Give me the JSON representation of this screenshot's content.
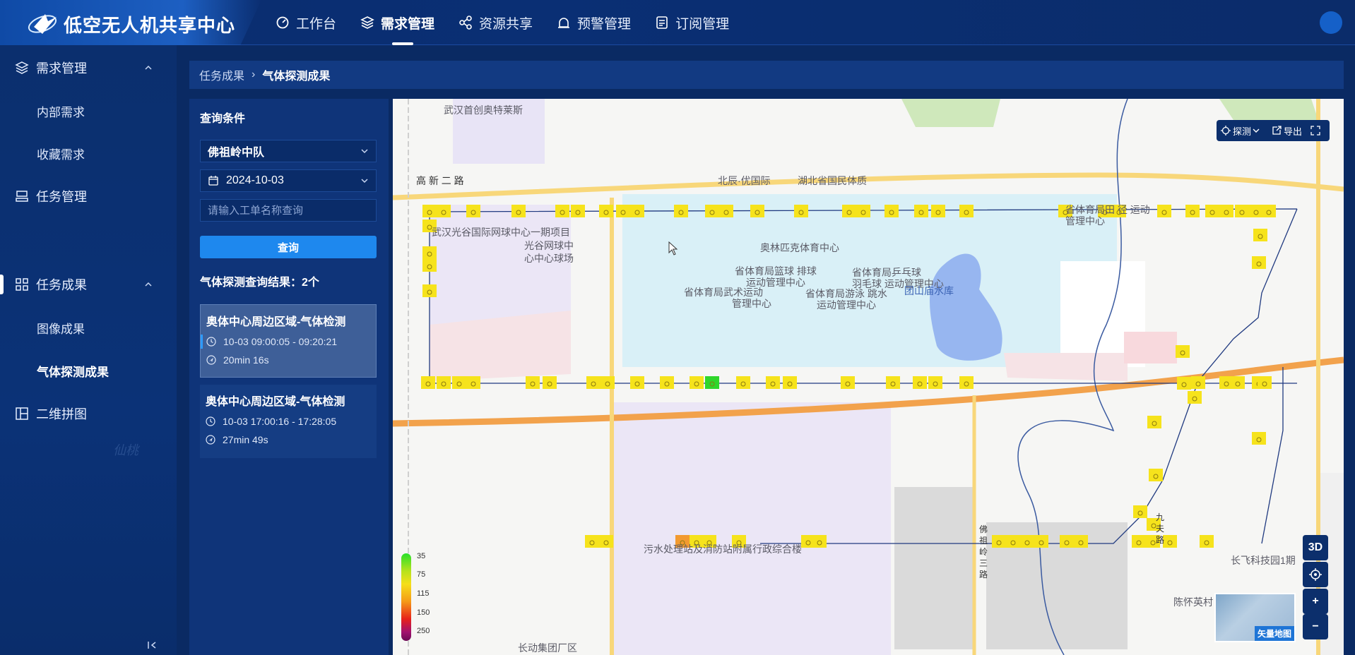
{
  "app": {
    "title": "低空无人机共享中心"
  },
  "nav": [
    {
      "label": "工作台",
      "icon": "dashboard-icon"
    },
    {
      "label": "需求管理",
      "icon": "layers-icon",
      "active": true
    },
    {
      "label": "资源共享",
      "icon": "share-icon"
    },
    {
      "label": "预警管理",
      "icon": "alarm-icon"
    },
    {
      "label": "订阅管理",
      "icon": "subscription-icon"
    }
  ],
  "sidebar": {
    "groups": [
      {
        "label": "需求管理",
        "icon": "layers-icon",
        "expanded": true
      },
      {
        "label": "任务管理",
        "icon": "task-icon"
      },
      {
        "label": "任务成果",
        "icon": "grid-icon",
        "expanded": true
      },
      {
        "label": "二维拼图",
        "icon": "mosaic-icon"
      }
    ],
    "subitems": {
      "demand": [
        "内部需求",
        "收藏需求"
      ],
      "results": [
        "图像成果",
        "气体探测成果"
      ]
    }
  },
  "breadcrumb": {
    "parent": "任务成果",
    "current": "气体探测成果"
  },
  "query": {
    "title": "查询条件",
    "team": "佛祖岭中队",
    "date": "2024-10-03",
    "search_placeholder": "请输入工单名称查询",
    "search_button": "查询",
    "result_count_text": "气体探测查询结果：2个"
  },
  "results": [
    {
      "title": "奥体中心周边区域-气体检测",
      "time": "10-03  09:00:05 - 09:20:21",
      "duration": "20min 16s",
      "active": true
    },
    {
      "title": "奥体中心周边区域-气体检测",
      "time": "10-03  17:00:16 - 17:28:05",
      "duration": "27min 49s",
      "active": false
    }
  ],
  "map": {
    "tools": {
      "detect": "探测",
      "export": "导出"
    },
    "controls": {
      "view3d": "3D",
      "zoom_in": "+",
      "zoom_out": "−"
    },
    "minimap_label": "矢量地图",
    "legend": [
      "35",
      "75",
      "115",
      "150",
      "250"
    ],
    "labels": {
      "outlet": "武汉首创奥特莱斯",
      "road1": "高 新 二 路",
      "beichen": "北辰·优国际",
      "hubei": "湖北省国民体质",
      "tennis": "武汉光谷国际网球中心一期项目",
      "tennis2": "光谷网球中",
      "tennis3": "心中心球场",
      "olympic": "奥林匹克体育中心",
      "basketball": "省体育局篮球 排球",
      "basketball2": "运动管理中心",
      "pingpong": "省体育局乒乓球",
      "pingpong2": "羽毛球 运动管理中心",
      "martial": "省体育局武术运动",
      "martial2": "管理中心",
      "swim": "省体育局游泳 跳水",
      "swim2": "运动管理中心",
      "reservoir": "团山庙水库",
      "track": "省体育局田 径 运动",
      "track2": "管理中心",
      "station": "污水处理站及消防站附属行政综合楼",
      "foziling": "佛 祖 岭 三 路",
      "jiufu": "九 夫 路",
      "changfei": "长飞科技园1期",
      "chenhuai": "陈怀英村",
      "changdong": "长动集团厂区"
    }
  }
}
